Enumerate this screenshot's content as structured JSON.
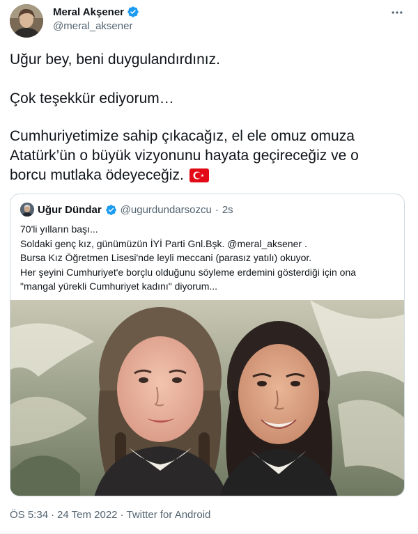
{
  "author": {
    "name": "Meral Akşener",
    "handle": "@meral_aksener",
    "verified_color": "#1d9bf0"
  },
  "tweet": {
    "lines": [
      "Uğur bey, beni duygulandırdınız.",
      "Çok teşekkür ediyorum…",
      "Cumhuriyetimize sahip çıkacağız, el ele omuz omuza",
      "Atatürk’ün o büyük vizyonunu hayata geçireceğiz ve o",
      "borcu mutlaka ödeyeceğiz."
    ],
    "flag_icon": "turkey-flag-icon"
  },
  "quote": {
    "name": "Uğur Dündar",
    "handle": "@ugurdundarsozcu",
    "separator": "·",
    "time": "2s",
    "lines": [
      "70'li yılların başı...",
      "Soldaki genç kız, günümüzün İYİ Parti Gnl.Bşk. @meral_aksener .",
      "Bursa Kız Öğretmen Lisesi'nde leyli meccani (parasız yatılı) okuyor.",
      "Her şeyini Cumhuriyet'e borçlu olduğunu söyleme erdemini gösterdiği için ona",
      "\"mangal yürekli Cumhuriyet kadını\" diyorum..."
    ]
  },
  "meta": {
    "time": "ÖS 5:34",
    "separator": "·",
    "date": "24 Tem 2022",
    "separator2": "·",
    "source": "Twitter for Android"
  },
  "colors": {
    "text": "#0f1419",
    "secondary": "#536471",
    "border": "#cfd9de",
    "verified": "#1d9bf0"
  }
}
